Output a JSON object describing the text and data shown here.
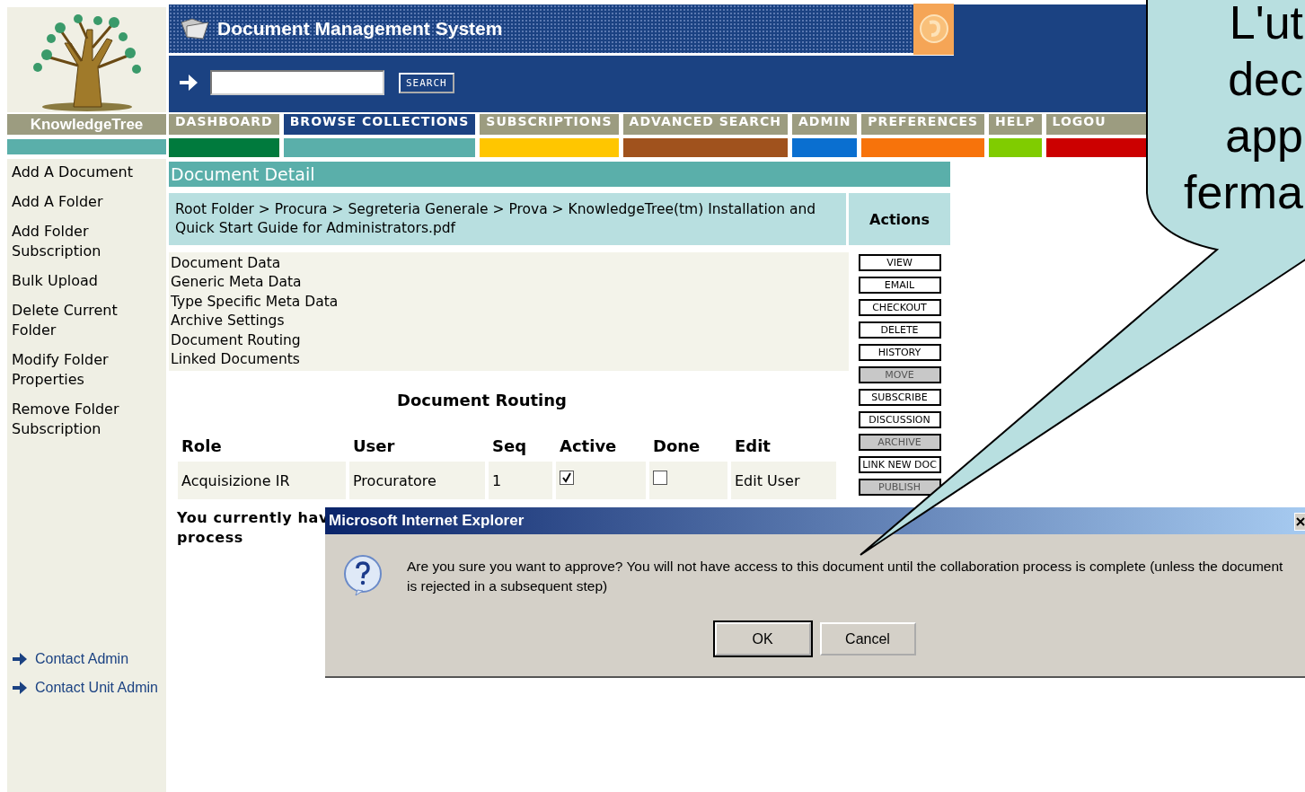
{
  "logo": {
    "wordmark": "KnowledgeTree"
  },
  "header": {
    "title": "Document Management System",
    "search_button": "SEARCH"
  },
  "nav": [
    {
      "label": "DASHBOARD",
      "selected": false,
      "color": "#007a3d"
    },
    {
      "label": "BROWSE COLLECTIONS",
      "selected": true,
      "color": "#5aafaa"
    },
    {
      "label": "SUBSCRIPTIONS",
      "selected": false,
      "color": "#ffc600"
    },
    {
      "label": "ADVANCED SEARCH",
      "selected": false,
      "color": "#a0521d"
    },
    {
      "label": "ADMIN",
      "selected": false,
      "color": "#0a6fd0"
    },
    {
      "label": "PREFERENCES",
      "selected": false,
      "color": "#f7730b"
    },
    {
      "label": "HELP",
      "selected": false,
      "color": "#80cc00"
    },
    {
      "label": "LOGOU",
      "selected": false,
      "color": "#cc0000"
    }
  ],
  "sidebar": {
    "items": [
      "Add A Document",
      "Add A Folder",
      "Add Folder Subscription",
      "Bulk Upload",
      "Delete Current Folder",
      "Modify Folder Properties",
      "Remove Folder Subscription"
    ],
    "contacts": [
      "Contact Admin",
      "Contact Unit Admin"
    ]
  },
  "document_detail": {
    "title": "Document Detail",
    "breadcrumb": "Root Folder > Procura > Segreteria Generale > Prova > KnowledgeTree(tm) Installation and Quick Start Guide for Administrators.pdf",
    "actions_heading": "Actions",
    "sections": [
      "Document Data",
      "Generic Meta Data",
      "Type Specific Meta Data",
      "Archive Settings",
      "Document Routing",
      "Linked Documents"
    ],
    "actions": [
      {
        "label": "VIEW",
        "disabled": false
      },
      {
        "label": "EMAIL",
        "disabled": false
      },
      {
        "label": "CHECKOUT",
        "disabled": false
      },
      {
        "label": "DELETE",
        "disabled": false
      },
      {
        "label": "HISTORY",
        "disabled": false
      },
      {
        "label": "MOVE",
        "disabled": true
      },
      {
        "label": "SUBSCRIBE",
        "disabled": false
      },
      {
        "label": "DISCUSSION",
        "disabled": false
      },
      {
        "label": "ARCHIVE",
        "disabled": true
      },
      {
        "label": "LINK NEW DOC",
        "disabled": false
      },
      {
        "label": "PUBLISH",
        "disabled": true
      }
    ]
  },
  "routing": {
    "title": "Document Routing",
    "columns": [
      "Role",
      "User",
      "Seq",
      "Active",
      "Done",
      "Edit"
    ],
    "rows": [
      {
        "role": "Acquisizione IR",
        "user": "Procuratore",
        "seq": "1",
        "active": true,
        "done": false,
        "edit": "Edit User"
      }
    ],
    "notice": [
      "You currently hav",
      "process"
    ]
  },
  "dialog": {
    "title": "Microsoft Internet Explorer",
    "message": "Are you sure you want to approve?  You will not have access to this document until the collaboration process is complete (unless the document is rejected in a subsequent step)",
    "buttons": [
      {
        "label": "OK",
        "selected": true
      },
      {
        "label": "Cancel",
        "selected": false
      }
    ]
  },
  "callout": {
    "lines": [
      "L'ut",
      "dec",
      "app",
      "ferma"
    ]
  }
}
